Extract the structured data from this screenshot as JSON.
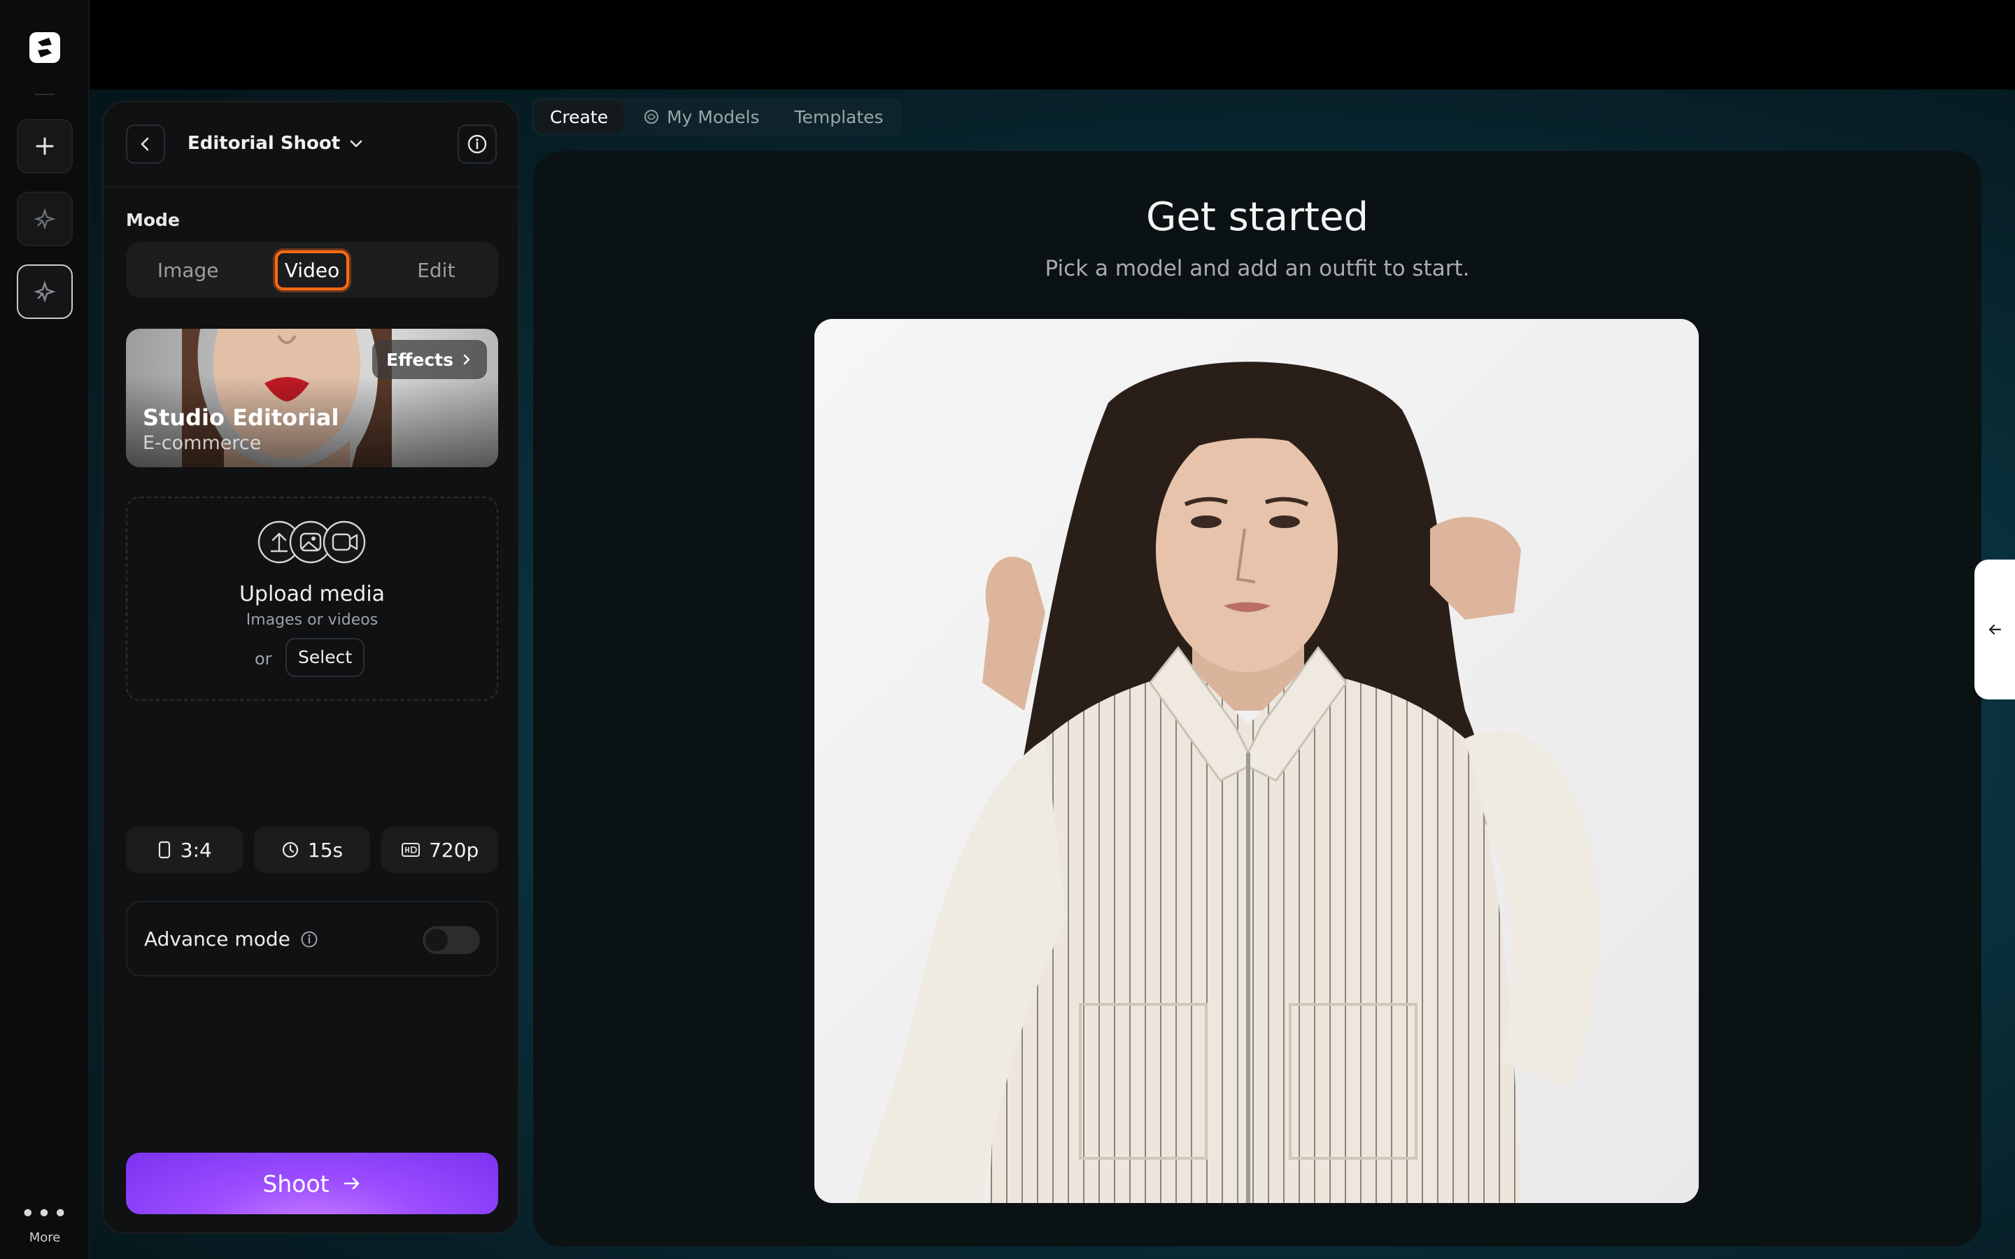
{
  "rail": {
    "more_label": "More"
  },
  "panel": {
    "workspace_title": "Editorial Shoot",
    "mode_label": "Mode",
    "modes": [
      "Image",
      "Video",
      "Edit"
    ],
    "selected_mode": "Video",
    "style_card": {
      "name": "Studio Editorial",
      "category": "E-commerce",
      "effects_label": "Effects"
    },
    "upload": {
      "title": "Upload media",
      "hint": "Images or videos",
      "or_label": "or",
      "select_label": "Select"
    },
    "settings": {
      "aspect_ratio": "3:4",
      "duration": "15s",
      "resolution": "720p"
    },
    "advance_mode": {
      "label": "Advance mode",
      "enabled": false
    },
    "shoot_label": "Shoot"
  },
  "tabs": [
    {
      "label": "Create",
      "active": true
    },
    {
      "label": "My Models",
      "active": false
    },
    {
      "label": "Templates",
      "active": false
    }
  ],
  "canvas": {
    "heading": "Get started",
    "subheading": "Pick a model and add an outfit to start."
  },
  "colors": {
    "accent_purple": "#8a3ffc",
    "focus_orange": "#ff6a13",
    "canvas_teal": "#0a3440"
  }
}
